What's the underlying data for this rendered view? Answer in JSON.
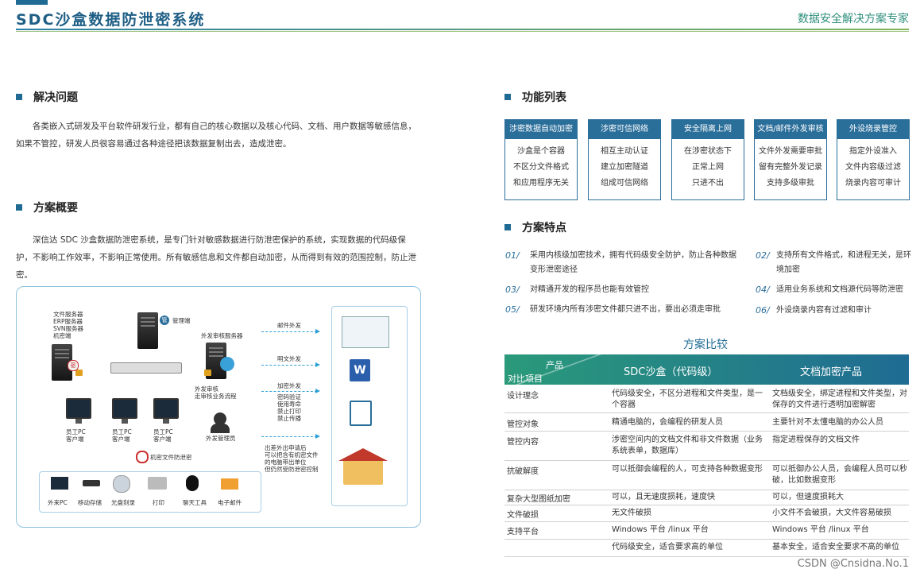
{
  "header": {
    "title": "SDC沙盒数据防泄密系统",
    "tagline": "数据安全解决方案专家"
  },
  "problem": {
    "heading": "解决问题",
    "text": "各类嵌入式研发及平台软件研发行业，都有自己的核心数据以及核心代码、文档、用户数据等敏感信息，如果不管控，研发人员很容易通过各种途径把该数据复制出去，造成泄密。"
  },
  "overview": {
    "heading": "方案概要",
    "text": "深信达 SDC 沙盒数据防泄密系统，是专门针对敏感数据进行防泄密保护的系统，实现数据的代码级保护，不影响工作效率，不影响正常使用。所有敏感信息和文件都自动加密，从而得到有效的范围控制，防止泄密。"
  },
  "diagram": {
    "file_servers": [
      "文件服务器",
      "ERP服务器",
      "SVN服务器",
      "机密端"
    ],
    "mgmt": "管理端",
    "mgmt_badge": "管",
    "secret_badge": "密",
    "audit_server": "外发审核服务器",
    "email_out": "邮件外发",
    "plain_out": "明文外发",
    "enc_out": "加密外发",
    "enc_features": [
      "密码验证",
      "使用寿命",
      "禁止打印",
      "禁止传播"
    ],
    "review": [
      "外发审核",
      "走审核业务流程"
    ],
    "admin": "外发管理员",
    "pcs": [
      {
        "a": "员工PC",
        "b": "客户端"
      },
      {
        "a": "员工PC",
        "b": "客户端"
      },
      {
        "a": "员工PC",
        "b": "客户端"
      }
    ],
    "note": [
      "出差外出申请后",
      "可以把含有机密文件",
      "的电脑带出单位",
      "但仍然受防泄密控制"
    ],
    "anti_leak": "机密文件防泄密",
    "devices": [
      "外来PC",
      "移动存储",
      "光盘刻录",
      "打印",
      "聊天工具",
      "电子邮件"
    ]
  },
  "functions": {
    "heading": "功能列表",
    "columns": [
      {
        "title": "涉密数据自动加密",
        "items": [
          "沙盒是个容器",
          "不区分文件格式",
          "和应用程序无关"
        ]
      },
      {
        "title": "涉密可信网络",
        "items": [
          "相互主动认证",
          "建立加密隧道",
          "组成可信网络"
        ]
      },
      {
        "title": "安全隔离上网",
        "items": [
          "在涉密状态下",
          "正常上网",
          "只进不出"
        ]
      },
      {
        "title": "文档/邮件外发审核",
        "items": [
          "文件外发需要审批",
          "留有完整外发记录",
          "支持多级审批"
        ]
      },
      {
        "title": "外设烧录管控",
        "items": [
          "指定外设准入",
          "文件内容级过滤",
          "烧录内容可审计"
        ]
      }
    ]
  },
  "features": {
    "heading": "方案特点",
    "items": [
      {
        "num": "01/",
        "text": "采用内核级加密技术，拥有代码级安全防护，防止各种数据变形泄密途径"
      },
      {
        "num": "02/",
        "text": "支持所有文件格式，和进程无关，是环境加密"
      },
      {
        "num": "03/",
        "text": "对精通开发的程序员也能有效管控"
      },
      {
        "num": "04/",
        "text": "适用业务系统和文档源代码等防泄密"
      },
      {
        "num": "05/",
        "text": "研发环境内所有涉密文件都只进不出，要出必须走审批"
      },
      {
        "num": "06/",
        "text": "外设烧录内容有过滤和审计"
      }
    ]
  },
  "comparison": {
    "title": "方案比较",
    "corner_top": "产品",
    "corner_bottom": "对比项目",
    "col_a": "SDC沙盒（代码级）",
    "col_b": "文档加密产品",
    "rows": [
      {
        "item": "设计理念",
        "a": "代码级安全，不区分进程和文件类型，是一个容器",
        "b": "文档级安全，绑定进程和文件类型，对保存的文件进行透明加密解密"
      },
      {
        "item": "管控对象",
        "a": "精通电脑的，会编程的研发人员",
        "b": "主要针对不太懂电脑的办公人员"
      },
      {
        "item": "管控内容",
        "a": "涉密空间内的文档文件和非文件数据（业务系统表单，数据库）",
        "b": "指定进程保存的文档文件"
      },
      {
        "item": "抗破解度",
        "a": "可以抵御会编程的人，可支持各种数据变形",
        "b": "可以抵御办公人员，会编程人员可以秒破，比如数据变形"
      },
      {
        "item": "复杂大型图纸加密",
        "a": "可以，且无速度损耗，速度快",
        "b": "可以，但速度损耗大"
      },
      {
        "item": "文件破损",
        "a": "无文件破损",
        "b": "小文件不会破损，大文件容易破损"
      },
      {
        "item": "支持平台",
        "a": "Windows 平台 /linux 平台",
        "b": "Windows 平台 /linux 平台"
      },
      {
        "item": "",
        "a": "代码级安全，适合要求高的单位",
        "b": "基本安全，适合安全要求不高的单位"
      }
    ]
  },
  "watermark": "CSDN @Cnsidna.No.1"
}
